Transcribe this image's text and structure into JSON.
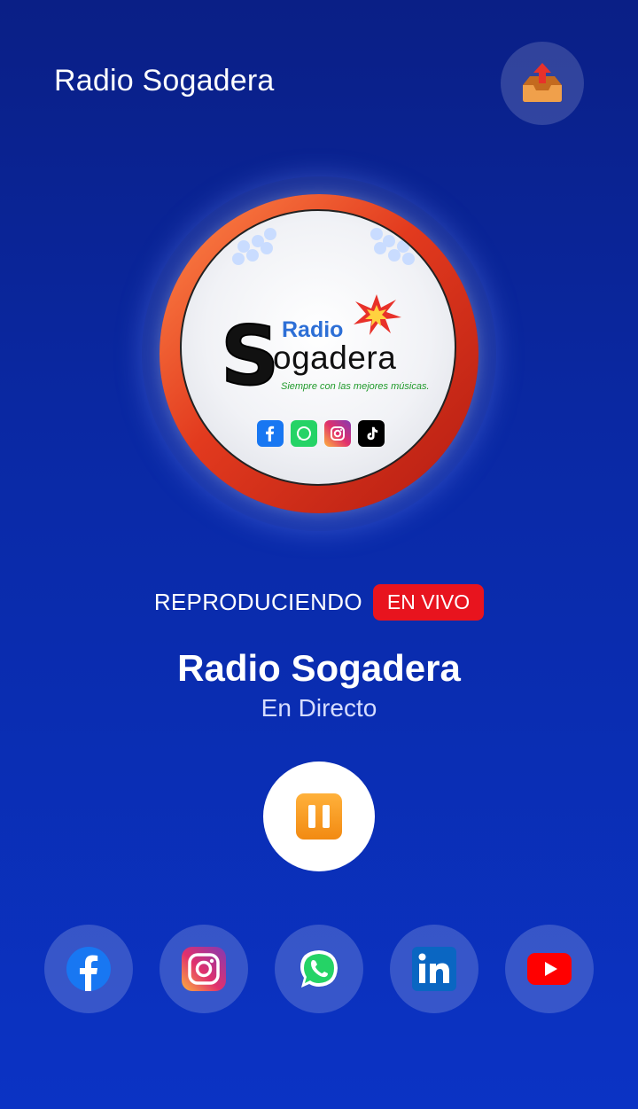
{
  "header": {
    "title": "Radio Sogadera",
    "share_icon": "outbox-tray-icon"
  },
  "artwork": {
    "logo_top": "Radio",
    "logo_initial": "S",
    "logo_rest": "ogadera",
    "tagline": "Siempre con las mejores músicas.",
    "mini_icons": [
      "facebook-icon",
      "whatsapp-icon",
      "instagram-icon",
      "tiktok-icon"
    ]
  },
  "player": {
    "status_label": "REPRODUCIENDO",
    "live_badge": "EN VIVO",
    "station": "Radio Sogadera",
    "subtitle": "En Directo",
    "state": "playing",
    "control_icon": "pause-icon"
  },
  "social": [
    {
      "name": "facebook",
      "icon": "facebook-icon",
      "color": "#1877f2"
    },
    {
      "name": "instagram",
      "icon": "instagram-icon",
      "color": "#e1306c"
    },
    {
      "name": "whatsapp",
      "icon": "whatsapp-icon",
      "color": "#25d366"
    },
    {
      "name": "linkedin",
      "icon": "linkedin-icon",
      "color": "#0a66c2"
    },
    {
      "name": "youtube",
      "icon": "youtube-icon",
      "color": "#ff0000"
    }
  ],
  "colors": {
    "background_top": "#0a1f86",
    "background_bottom": "#0b33c4",
    "live_badge": "#e8141e",
    "pause_accent": "#f28a12"
  }
}
